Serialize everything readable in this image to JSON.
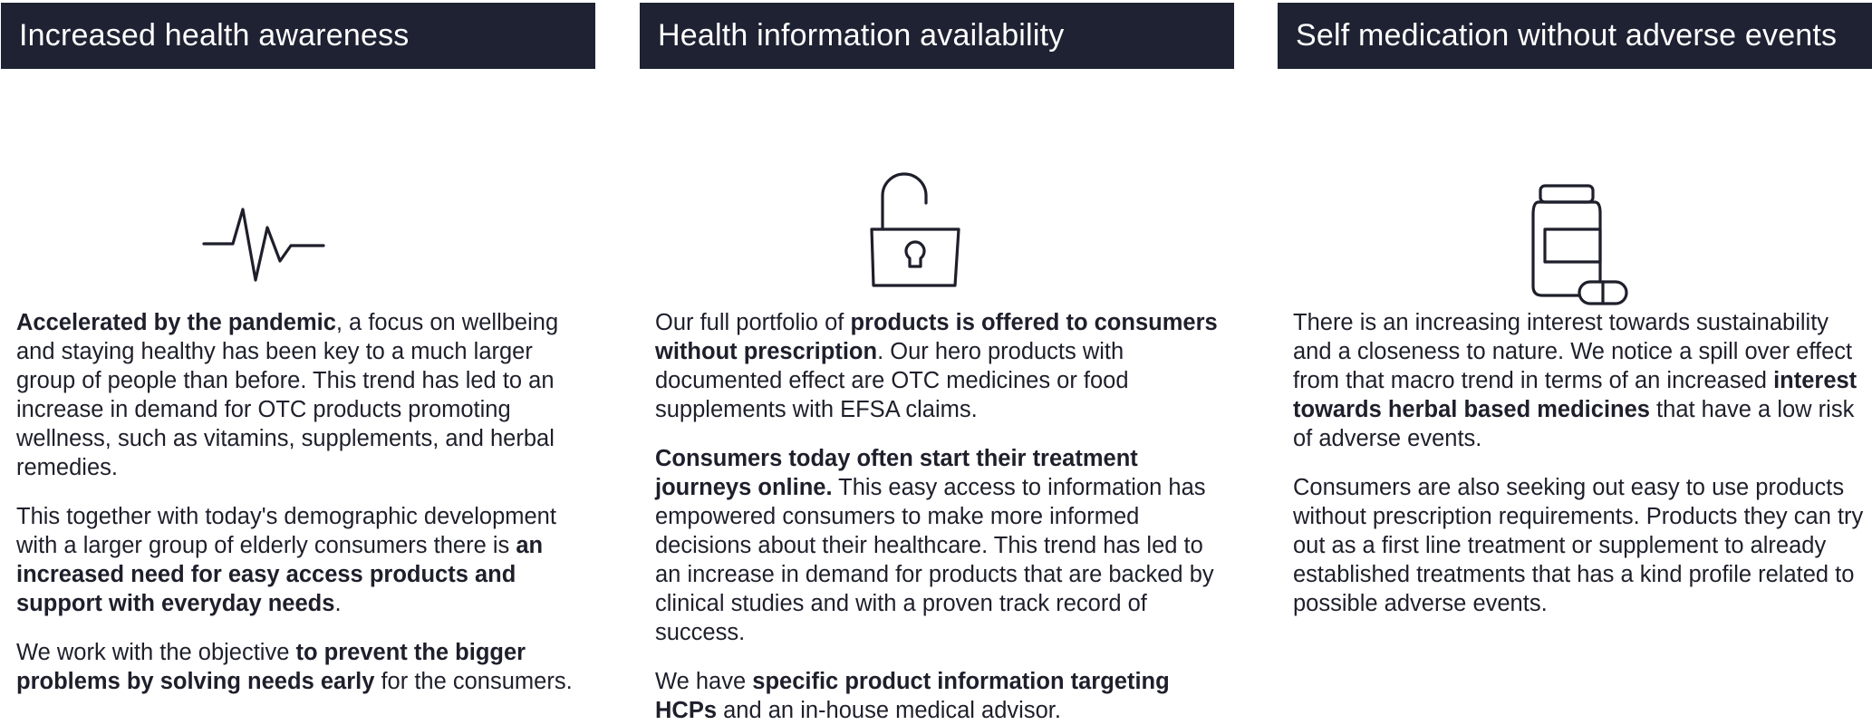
{
  "columns": [
    {
      "title": "Increased health awareness",
      "icon": "heartbeat-icon",
      "paragraphs": [
        [
          {
            "t": "Accelerated by the pandemic",
            "b": true
          },
          {
            "t": ", a focus on wellbeing and staying healthy has been key to a much larger group of people than before. This trend has led to an increase in demand for OTC products promoting wellness, such as vitamins, supplements, and herbal remedies.",
            "b": false
          }
        ],
        [
          {
            "t": "This together with today's demographic development with a larger group of elderly consumers there is ",
            "b": false
          },
          {
            "t": "an increased need for easy access products and support with everyday needs",
            "b": true
          },
          {
            "t": ".",
            "b": false
          }
        ],
        [
          {
            "t": "We work with the objective ",
            "b": false
          },
          {
            "t": "to prevent the bigger problems by solving needs early",
            "b": true
          },
          {
            "t": " for the consumers.",
            "b": false
          }
        ]
      ]
    },
    {
      "title": "Health information availability",
      "icon": "unlocked-padlock-icon",
      "paragraphs": [
        [
          {
            "t": "Our full portfolio of ",
            "b": false
          },
          {
            "t": "products is offered to consumers without prescription",
            "b": true
          },
          {
            "t": ". Our hero products with documented effect are OTC medicines or food supplements with EFSA claims.",
            "b": false
          }
        ],
        [
          {
            "t": "Consumers today often start their treatment journeys online.",
            "b": true
          },
          {
            "t": " This easy access to information has empowered consumers to make more informed decisions about their healthcare. This trend has led to an increase in demand for products that are backed by clinical studies and with a proven track record of success.",
            "b": false
          }
        ],
        [
          {
            "t": "We have ",
            "b": false
          },
          {
            "t": "specific product information targeting HCPs",
            "b": true
          },
          {
            "t": " and an in-house medical advisor.",
            "b": false
          }
        ]
      ]
    },
    {
      "title": "Self medication without adverse events",
      "icon": "medicine-bottle-pill-icon",
      "paragraphs": [
        [
          {
            "t": "There is an increasing interest towards sustainability and a closeness to nature. We notice a spill over effect from that macro trend in terms of an increased  ",
            "b": false
          },
          {
            "t": "interest towards herbal based medicines",
            "b": true
          },
          {
            "t": " that have a low risk of adverse events.",
            "b": false
          }
        ],
        [
          {
            "t": "Consumers are also seeking out easy to use products without prescription requirements. Products they can try out as a first line treatment or supplement to already established treatments that has a kind profile related to possible adverse events.",
            "b": false
          }
        ]
      ]
    }
  ]
}
